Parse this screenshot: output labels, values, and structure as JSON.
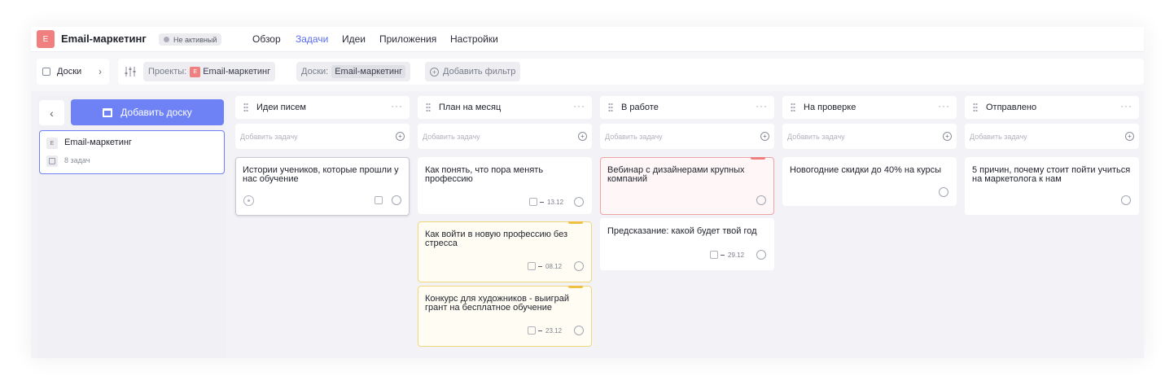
{
  "header": {
    "logo_letter": "E",
    "title": "Email-маркетинг",
    "status": "Не активный",
    "nav": [
      "Обзор",
      "Задачи",
      "Идеи",
      "Приложения",
      "Настройки"
    ],
    "active_nav": "Задачи"
  },
  "filterbar": {
    "boards_label": "Доски",
    "projects_label": "Проекты:",
    "projects_value": "Email-маркетинг",
    "project_logo_letter": "E",
    "boards_filter_label": "Доски:",
    "boards_filter_value": "Email-маркетинг",
    "add_filter": "Добавить фильтр"
  },
  "sidebar": {
    "add_board": "Добавить доску",
    "board": {
      "logo_letter": "E",
      "title": "Email-маркетинг",
      "count": "8 задач"
    }
  },
  "columns": [
    {
      "title": "Идеи писем",
      "add_placeholder": "Добавить задачу",
      "cards": [
        {
          "text": "Истории учеников, которые прошли у нас обучение",
          "date": ""
        }
      ]
    },
    {
      "title": "План на месяц",
      "add_placeholder": "Добавить задачу",
      "cards": [
        {
          "text": "Как понять, что пора менять профессию",
          "date": "13.12"
        },
        {
          "text": "Как войти в новую профессию без стресса",
          "date": "08.12"
        },
        {
          "text": "Конкурс для художников - выиграй грант на бесплатное обучение",
          "date": "23.12"
        }
      ]
    },
    {
      "title": "В работе",
      "add_placeholder": "Добавить задачу",
      "cards": [
        {
          "text": "Вебинар с дизайнерами крупных компаний",
          "date": ""
        },
        {
          "text": "Предсказание: какой будет твой год",
          "date": "29.12"
        }
      ]
    },
    {
      "title": "На проверке",
      "add_placeholder": "Добавить задачу",
      "cards": [
        {
          "text": "Новогодние скидки до 40% на курсы",
          "date": ""
        }
      ]
    },
    {
      "title": "Отправлено",
      "add_placeholder": "Добавить задачу",
      "cards": [
        {
          "text": "5 причин, почему стоит пойти учиться на маркетолога к нам",
          "date": ""
        }
      ]
    }
  ],
  "colors": {
    "accent": "#6e82f6",
    "project_logo": "#f08080",
    "priority_yellow": "#f0c040",
    "priority_red": "#f08080"
  },
  "icons": {
    "back": "chevron-left-icon",
    "crumb": "chevron-right-icon",
    "filter": "sliders-icon",
    "add": "plus-circle-icon",
    "more": "more-horizontal-icon",
    "drag": "drag-handle-icon",
    "complete": "circle-check-icon",
    "calendar": "calendar-icon",
    "timer": "timer-icon"
  }
}
